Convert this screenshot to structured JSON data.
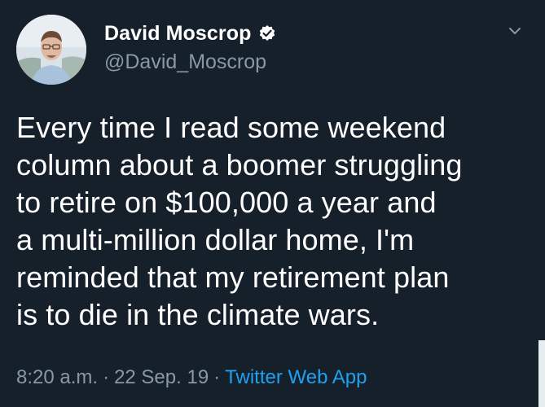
{
  "author": {
    "display_name": "David Moscrop",
    "handle": "@David_Moscrop",
    "verified_icon": "verified-badge-icon"
  },
  "tweet": {
    "text": "Every time I read some weekend\ncolumn about a boomer struggling\nto retire on $100,000 a year and\na multi-million dollar home, I'm\nreminded that my retirement plan\nis to die in the climate wars."
  },
  "meta": {
    "time": "8:20 a.m.",
    "separator": "·",
    "date": "22 Sep. 19",
    "source": "Twitter Web App"
  },
  "colors": {
    "background": "#15202b",
    "primary_text": "#ffffff",
    "secondary_text": "#8899a6",
    "link": "#1da1f2"
  }
}
